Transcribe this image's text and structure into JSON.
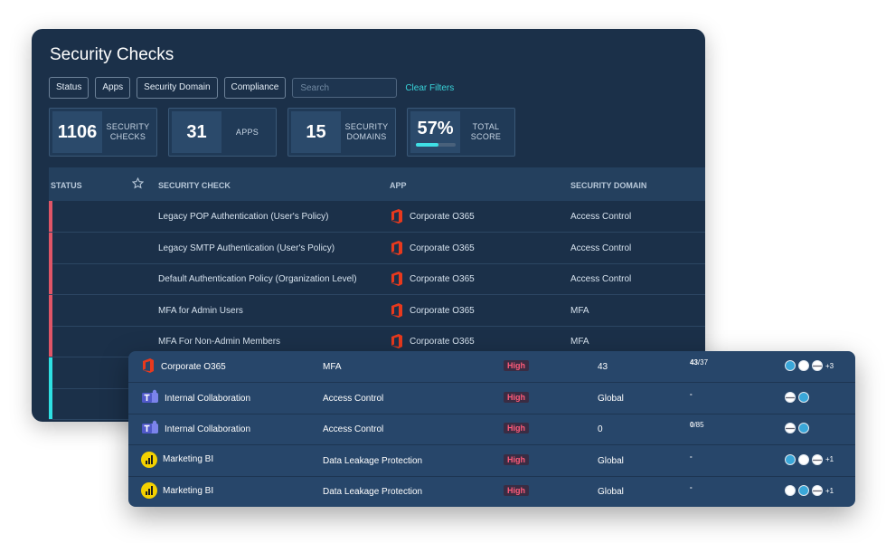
{
  "panel": {
    "title": "Security Checks",
    "filters": [
      "Status",
      "Apps",
      "Security Domain",
      "Compliance"
    ],
    "search_placeholder": "Search",
    "clear_label": "Clear Filters"
  },
  "stats": [
    {
      "value": "1106",
      "label_1": "SECURITY",
      "label_2": "CHECKS"
    },
    {
      "value": "31",
      "label_1": "APPS",
      "label_2": ""
    },
    {
      "value": "15",
      "label_1": "SECURITY",
      "label_2": "DOMAINS"
    },
    {
      "value": "57%",
      "label_1": "TOTAL",
      "label_2": "SCORE",
      "progress": 0.57
    }
  ],
  "table": {
    "headers": {
      "status": "STATUS",
      "check": "SECURITY CHECK",
      "app": "APP",
      "domain": "SECURITY DOMAIN"
    },
    "rows": [
      {
        "check": "Legacy POP Authentication (User's Policy)",
        "app": "Corporate O365",
        "domain": "Access Control",
        "status_color": "#e05567"
      },
      {
        "check": "Legacy SMTP Authentication (User's Policy)",
        "app": "Corporate O365",
        "domain": "Access Control",
        "status_color": "#e05567"
      },
      {
        "check": "Default Authentication Policy (Organization Level)",
        "app": "Corporate O365",
        "domain": "Access Control",
        "status_color": "#e05567"
      },
      {
        "check": "MFA for Admin Users",
        "app": "Corporate O365",
        "domain": "MFA",
        "status_color": "#e05567"
      },
      {
        "check": "MFA For Non-Admin Members",
        "app": "Corporate O365",
        "domain": "MFA",
        "status_color": "#e05567"
      },
      {
        "check": "",
        "app": "",
        "domain": "",
        "status_color": "#2ee0e3"
      },
      {
        "check": "",
        "app": "",
        "domain": "",
        "status_color": "#2ee0e3"
      }
    ]
  },
  "overlay": {
    "rows": [
      {
        "app": "Corporate O365",
        "icon": "office-icon",
        "domain": "MFA",
        "severity": "High",
        "scope": "43",
        "progress_bold": "43",
        "progress_rest": "/37",
        "extra": "+3"
      },
      {
        "app": "Internal Collaboration",
        "icon": "teams-icon",
        "domain": "Access Control",
        "severity": "High",
        "scope": "Global",
        "progress_bold": "-",
        "progress_rest": "",
        "extra": ""
      },
      {
        "app": "Internal Collaboration",
        "icon": "teams-icon",
        "domain": "Access Control",
        "severity": "High",
        "scope": "0",
        "progress_bold": "0",
        "progress_rest": "/85",
        "extra": ""
      },
      {
        "app": "Marketing BI",
        "icon": "power-bi-icon",
        "domain": "Data Leakage Protection",
        "severity": "High",
        "scope": "Global",
        "progress_bold": "-",
        "progress_rest": "",
        "extra": "+1"
      },
      {
        "app": "Marketing BI",
        "icon": "power-bi-icon",
        "domain": "Data Leakage Protection",
        "severity": "High",
        "scope": "Global",
        "progress_bold": "-",
        "progress_rest": "",
        "extra": "+1"
      }
    ]
  },
  "colors": {
    "panel_bg": "#1b3049",
    "accent": "#39d4d9",
    "fail": "#e05567",
    "pass": "#2ee0e3",
    "severity_high": "#ff5b7a"
  }
}
